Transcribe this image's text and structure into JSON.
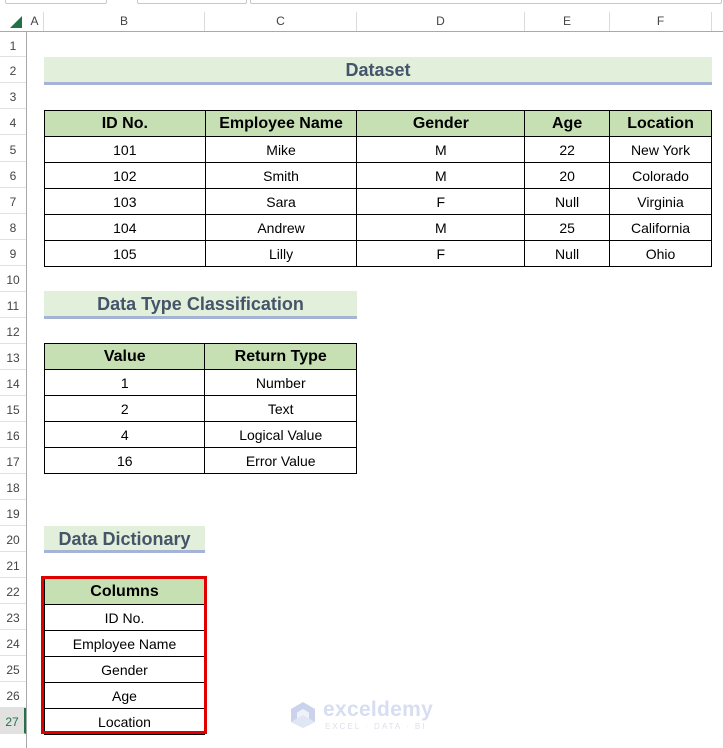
{
  "spreadsheet": {
    "column_headers": [
      "A",
      "B",
      "C",
      "D",
      "E",
      "F"
    ],
    "row_headers": [
      "1",
      "2",
      "3",
      "4",
      "5",
      "6",
      "7",
      "8",
      "9",
      "10",
      "11",
      "12",
      "13",
      "14",
      "15",
      "16",
      "17",
      "18",
      "19",
      "20",
      "21",
      "22",
      "23",
      "24",
      "25",
      "26",
      "27"
    ],
    "selected_row": "27"
  },
  "dataset": {
    "title": "Dataset",
    "headers": [
      "ID No.",
      "Employee Name",
      "Gender",
      "Age",
      "Location"
    ],
    "rows": [
      [
        "101",
        "Mike",
        "M",
        "22",
        "New York"
      ],
      [
        "102",
        "Smith",
        "M",
        "20",
        "Colorado"
      ],
      [
        "103",
        "Sara",
        "F",
        "Null",
        "Virginia"
      ],
      [
        "104",
        "Andrew",
        "M",
        "25",
        "California"
      ],
      [
        "105",
        "Lilly",
        "F",
        "Null",
        "Ohio"
      ]
    ]
  },
  "classification": {
    "title": "Data Type Classification",
    "headers": [
      "Value",
      "Return Type"
    ],
    "rows": [
      [
        "1",
        "Number"
      ],
      [
        "2",
        "Text"
      ],
      [
        "4",
        "Logical Value"
      ],
      [
        "16",
        "Error Value"
      ]
    ]
  },
  "dictionary": {
    "title": "Data Dictionary",
    "header": "Columns",
    "rows": [
      "ID No.",
      "Employee Name",
      "Gender",
      "Age",
      "Location"
    ],
    "highlight_color": "#e00000"
  },
  "watermark": {
    "name": "exceldemy",
    "tagline": "EXCEL · DATA · BI"
  }
}
